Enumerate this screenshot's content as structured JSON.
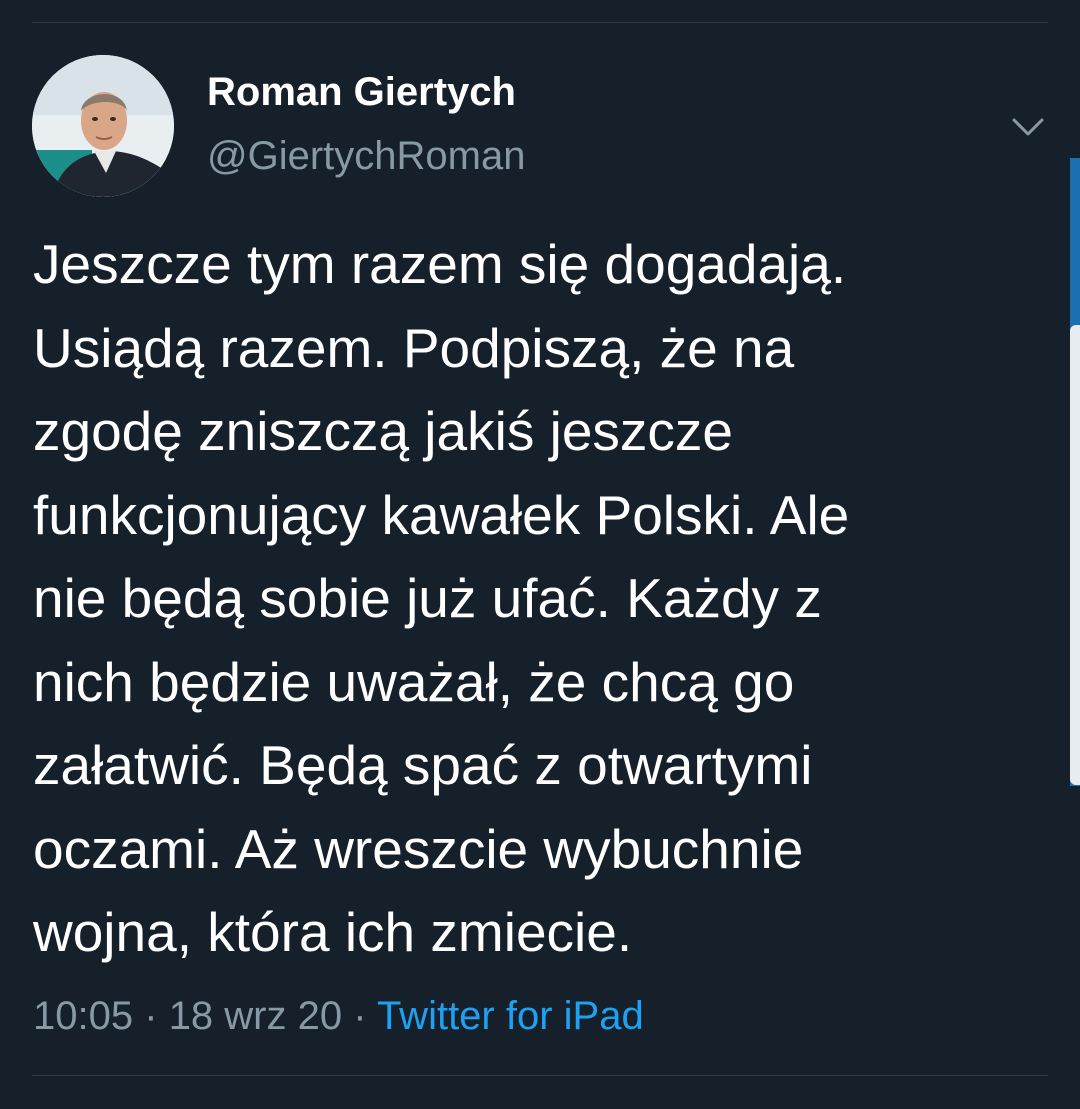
{
  "user": {
    "display_name": "Roman Giertych",
    "handle": "@GiertychRoman"
  },
  "tweet": {
    "lines": [
      "Jeszcze tym razem się dogadają.",
      "Usiądą razem. Podpiszą, że na",
      "zgodę zniszczą jakiś jeszcze",
      "funkcjonujący kawałek Polski. Ale",
      "nie będą sobie już ufać. Każdy z",
      "nich będzie uważał, że chcą go",
      "załatwić. Będą spać z otwartymi",
      "oczami. Aż wreszcie wybuchnie",
      "wojna, która ich zmiecie."
    ],
    "time": "10:05",
    "separator": "·",
    "date": "18 wrz 20",
    "source": "Twitter for iPad"
  },
  "icons": {
    "menu": "chevron-down-icon",
    "avatar": "avatar-photo"
  },
  "colors": {
    "background": "#15202b",
    "text": "#ffffff",
    "secondary": "#8899a6",
    "link": "#1da1f2",
    "divider": "#2f3b47"
  }
}
